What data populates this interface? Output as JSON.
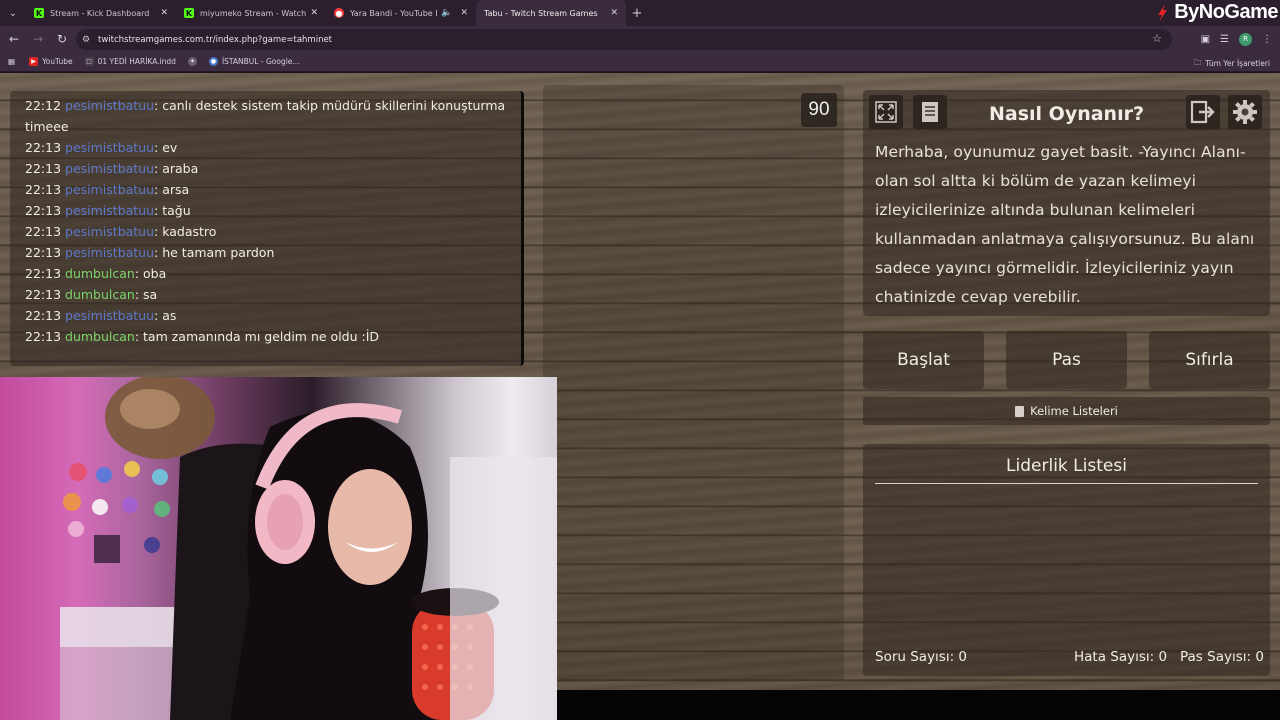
{
  "browser": {
    "tabs": [
      {
        "title": "Stream - Kick Dashboard",
        "favicon": "kick-icon",
        "color": "#53fc18"
      },
      {
        "title": "miyumeko Stream - Watch Live",
        "favicon": "kick-icon",
        "color": "#53fc18"
      },
      {
        "title": "Yara Bandi - YouTube Music",
        "favicon": "youtube-music-icon",
        "color": "#ff3b3b"
      },
      {
        "title": "Tabu - Twitch Stream Games",
        "favicon": "",
        "color": ""
      }
    ],
    "active_tab": 3,
    "url": "twitchstreamgames.com.tr/index.php?game=tahminet",
    "bookmarks": [
      {
        "label": "YouTube",
        "icon": "youtube-icon"
      },
      {
        "label": "01 YEDİ HARİKA.indd",
        "icon": "document-icon"
      },
      {
        "label": "",
        "icon": "globe-icon"
      },
      {
        "label": "İSTANBUL - Google...",
        "icon": "globe-icon"
      }
    ],
    "all_bookmarks_label": "Tüm Yer İşaretleri",
    "profile_initial": "R"
  },
  "watermark": "ByNoGame",
  "chat": [
    {
      "time": "22:12",
      "user": "pesimistbatuu",
      "color": "blue",
      "text": ": canlı destek sistem takip müdürü skillerini konuşturma timeee"
    },
    {
      "time": "22:13",
      "user": "pesimistbatuu",
      "color": "blue",
      "text": ": ev"
    },
    {
      "time": "22:13",
      "user": "pesimistbatuu",
      "color": "blue",
      "text": ": araba"
    },
    {
      "time": "22:13",
      "user": "pesimistbatuu",
      "color": "blue",
      "text": ": arsa"
    },
    {
      "time": "22:13",
      "user": "pesimistbatuu",
      "color": "blue",
      "text": ": tağu"
    },
    {
      "time": "22:13",
      "user": "pesimistbatuu",
      "color": "blue",
      "text": ": kadastro"
    },
    {
      "time": "22:13",
      "user": "pesimistbatuu",
      "color": "blue",
      "text": ": he tamam pardon"
    },
    {
      "time": "22:13",
      "user": "dumbulcan",
      "color": "green",
      "text": ": oba"
    },
    {
      "time": "22:13",
      "user": "dumbulcan",
      "color": "green",
      "text": ": sa"
    },
    {
      "time": "22:13",
      "user": "pesimistbatuu",
      "color": "blue",
      "text": ": as"
    },
    {
      "time": "22:13",
      "user": "dumbulcan",
      "color": "green",
      "text": ": tam zamanında mı geldim ne oldu :İD"
    }
  ],
  "game": {
    "timer": "90",
    "howto_title": "Nasıl Oynanır?",
    "howto_text": "Merhaba, oyunumuz gayet basit. -Yayıncı Alanı- olan sol altta ki bölüm de yazan kelimeyi izleyicilerinize altında bulunan kelimeleri kullanmadan anlatmaya çalışıyorsunuz. Bu alanı sadece yayıncı görmelidir. İzleyicileriniz yayın chatinizde cevap verebilir.",
    "buttons": {
      "start": "Başlat",
      "pass": "Pas",
      "reset": "Sıfırla"
    },
    "word_lists": "Kelime Listeleri",
    "leaderboard_title": "Liderlik Listesi",
    "stats": {
      "questions": "Soru Sayısı: 0",
      "errors": "Hata Sayısı: 0",
      "passes": "Pas Sayısı: 0"
    }
  }
}
